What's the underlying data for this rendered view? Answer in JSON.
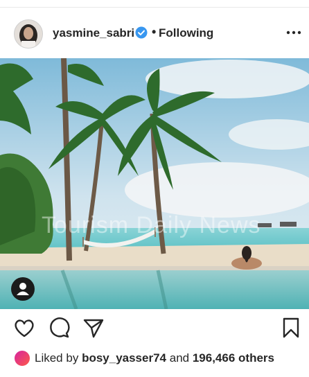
{
  "post": {
    "username": "yasmine_sabri",
    "separator": "•",
    "follow_status": "Following",
    "watermark": "Tourism Daily News"
  },
  "icons": {
    "verified": "verified-badge-icon",
    "more": "more-options-icon",
    "like": "heart-icon",
    "comment": "comment-icon",
    "share": "send-icon",
    "save": "bookmark-icon",
    "tag": "user-tag-icon"
  },
  "likes": {
    "prefix": "Liked by",
    "liker": "bosy_yasser74",
    "joiner": "and",
    "others": "196,466 others"
  },
  "colors": {
    "verified": "#3897f0",
    "text": "#262626"
  }
}
